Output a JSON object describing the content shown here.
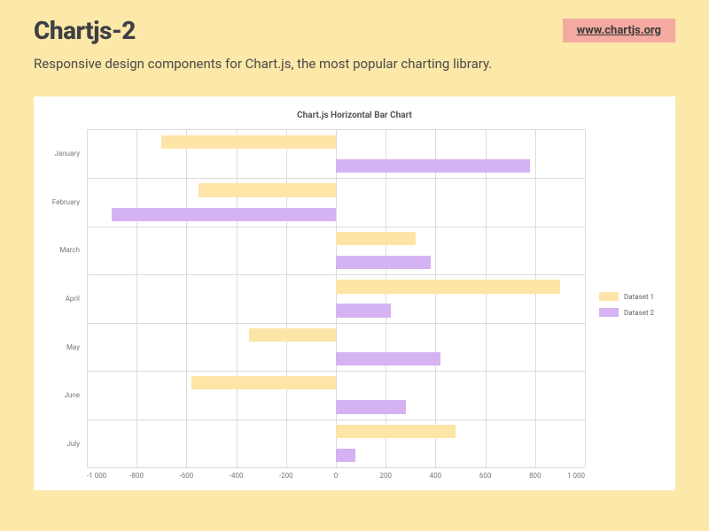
{
  "header": {
    "title": "Chartjs-2",
    "link_label": "www.chartjs.org",
    "subtitle": "Responsive design components for Chart.js, the most popular charting library."
  },
  "chart_data": {
    "type": "bar",
    "orientation": "horizontal",
    "title": "Chart.js Horizontal Bar Chart",
    "categories": [
      "January",
      "February",
      "March",
      "April",
      "May",
      "June",
      "July"
    ],
    "series": [
      {
        "name": "Dataset 1",
        "color": "#fde5a7",
        "values": [
          -700,
          -550,
          320,
          900,
          -350,
          -580,
          480
        ]
      },
      {
        "name": "Dataset 2",
        "color": "#d5b3f2",
        "values": [
          780,
          -900,
          380,
          220,
          420,
          280,
          80
        ]
      }
    ],
    "xlabel": "",
    "ylabel": "",
    "xlim": [
      -1000,
      1000
    ],
    "x_ticks": [
      "-1 000",
      "-800",
      "-600",
      "-400",
      "-200",
      "0",
      "200",
      "400",
      "600",
      "800",
      "1 000"
    ],
    "legend_position": "right",
    "grid": true
  }
}
